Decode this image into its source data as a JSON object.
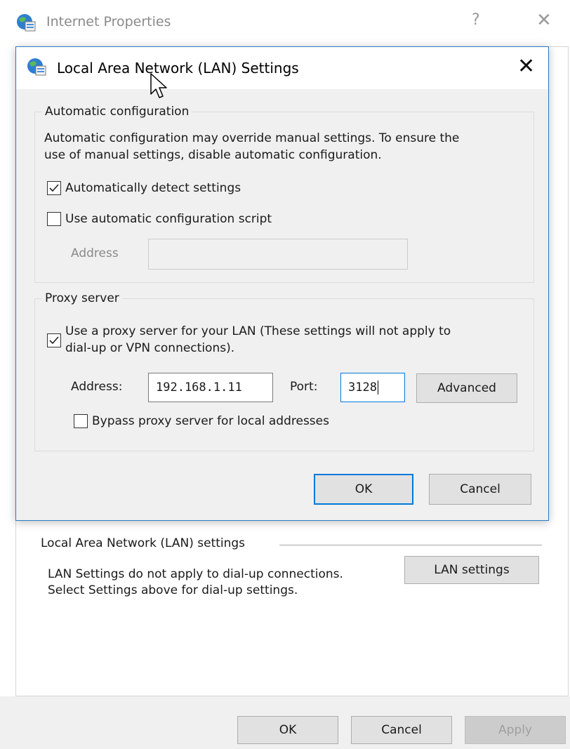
{
  "outer_window": {
    "title": "Internet Properties",
    "help_glyph": "?",
    "close_glyph": "✕",
    "lan_section": {
      "legend": "Local Area Network (LAN) settings",
      "description_line1": "LAN Settings do not apply to dial-up connections.",
      "description_line2": "Select Settings above for dial-up settings.",
      "lan_settings_button": "LAN settings"
    },
    "footer": {
      "ok_label": "OK",
      "cancel_label": "Cancel",
      "apply_label": "Apply"
    }
  },
  "dialog": {
    "title": "Local Area Network (LAN) Settings",
    "close_glyph": "✕",
    "automatic_configuration": {
      "legend": "Automatic configuration",
      "description_line1": "Automatic configuration may override manual settings.  To ensure the",
      "description_line2": "use of manual settings, disable automatic configuration.",
      "auto_detect": {
        "label": "Automatically detect settings",
        "checked": true
      },
      "auto_script": {
        "label": "Use automatic configuration script",
        "checked": false
      },
      "address_label": "Address",
      "address_value": ""
    },
    "proxy_server": {
      "legend": "Proxy server",
      "use_proxy": {
        "label_line1": "Use a proxy server for your LAN (These settings will not apply to",
        "label_line2": "dial-up or VPN connections).",
        "checked": true
      },
      "address_label": "Address:",
      "address_value": "192.168.1.11",
      "port_label": "Port:",
      "port_value": "3128",
      "advanced_button": "Advanced",
      "bypass": {
        "label": "Bypass proxy server for local addresses",
        "checked": false
      }
    },
    "ok_label": "OK",
    "cancel_label": "Cancel"
  },
  "icons": {
    "window_icon": "globe-icon",
    "cursor": "mouse-cursor-icon"
  },
  "colors": {
    "accent": "#0078d7",
    "dialog_border": "#2b78c5",
    "dialog_background": "#f0f0f0"
  }
}
